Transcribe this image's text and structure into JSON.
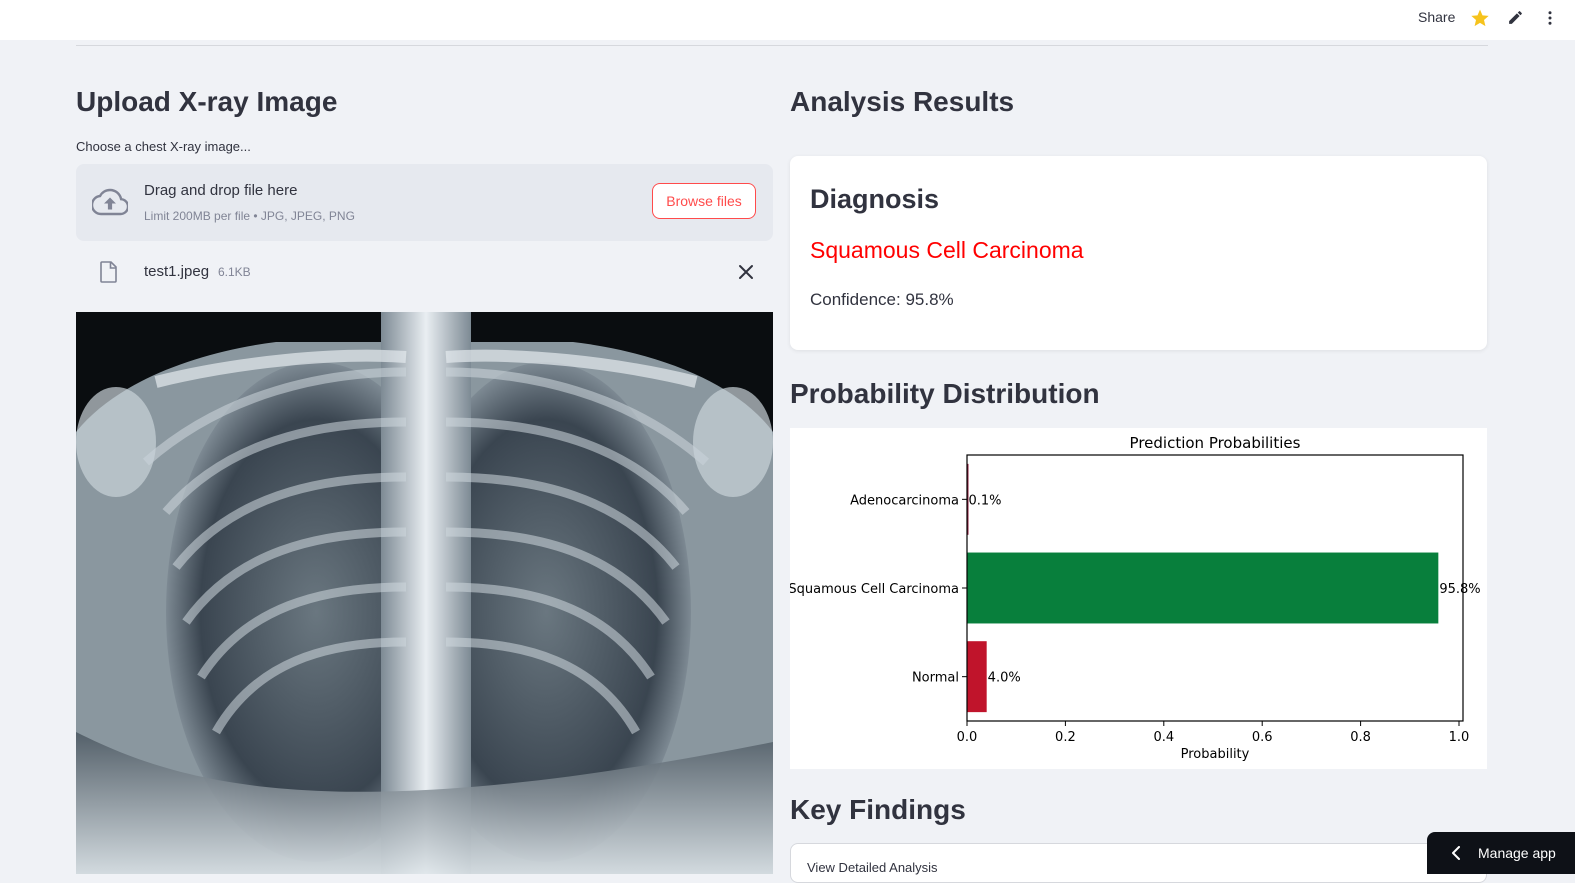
{
  "topbar": {
    "share_label": "Share"
  },
  "upload": {
    "heading": "Upload X-ray Image",
    "choose_label": "Choose a chest X-ray image...",
    "drop_title": "Drag and drop file here",
    "drop_limit": "Limit 200MB per file • JPG, JPEG, PNG",
    "browse_label": "Browse files",
    "file_name": "test1.jpeg",
    "file_size": "6.1KB"
  },
  "results": {
    "heading": "Analysis Results",
    "diagnosis_title": "Diagnosis",
    "diagnosis_value": "Squamous Cell Carcinoma",
    "confidence": "Confidence: 95.8%"
  },
  "probability": {
    "heading": "Probability Distribution"
  },
  "findings": {
    "heading": "Key Findings",
    "expander_label": "View Detailed Analysis"
  },
  "manage": {
    "label": "Manage app"
  },
  "colors": {
    "accent": "#ff4b4b",
    "diagnosis": "#ff0000",
    "bar_green": "#087f3c",
    "bar_red": "#c0142b"
  },
  "chart_data": {
    "type": "bar",
    "orientation": "horizontal",
    "title": "Prediction Probabilities",
    "xlabel": "Probability",
    "ylabel": "",
    "xlim": [
      0,
      1.0
    ],
    "xticks": [
      "0.0",
      "0.2",
      "0.4",
      "0.6",
      "0.8",
      "1.0"
    ],
    "categories": [
      "Adenocarcinoma",
      "Squamous Cell Carcinoma",
      "Normal"
    ],
    "values": [
      0.001,
      0.958,
      0.04
    ],
    "labels": [
      "0.1%",
      "95.8%",
      "4.0%"
    ],
    "colors": [
      "#8b1a3a",
      "#087f3c",
      "#c0142b"
    ],
    "grid": false
  }
}
